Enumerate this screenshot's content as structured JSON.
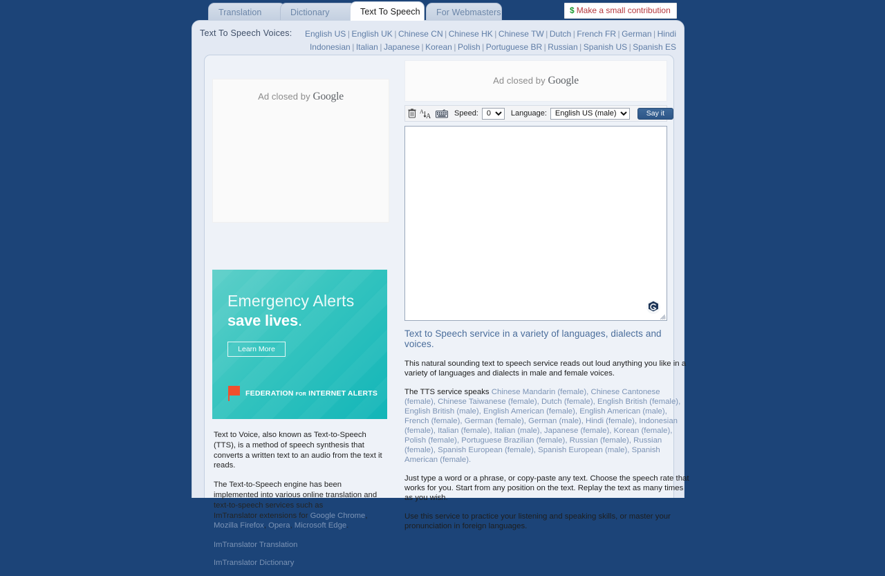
{
  "tabs": [
    {
      "label": "Translation",
      "active": false
    },
    {
      "label": "Dictionary",
      "active": false
    },
    {
      "label": "Text To Speech",
      "active": true
    },
    {
      "label": "For Webmasters",
      "active": false
    }
  ],
  "contribution": {
    "symbol": "$",
    "label": "Make a small contribution"
  },
  "voices": {
    "title": "Text To Speech Voices:",
    "row1": [
      "English US",
      "English UK",
      "Chinese CN",
      "Chinese HK",
      "Chinese TW",
      "Dutch",
      "French FR",
      "German",
      "Hindi"
    ],
    "row2": [
      "Indonesian",
      "Italian",
      "Japanese",
      "Korean",
      "Polish",
      "Portuguese BR",
      "Russian",
      "Spanish US",
      "Spanish ES"
    ],
    "separator": "|"
  },
  "ads": {
    "closed_text": "Ad closed by ",
    "google": "Google",
    "banner": {
      "line1": "Emergency Alerts",
      "line2": "save lives",
      "line2_dot": ".",
      "cta": "Learn More",
      "brand_1": "FEDERATION ",
      "brand_small": "FOR",
      "brand_2": " INTERNET ALERTS"
    }
  },
  "toolbar": {
    "icons": [
      "trash-icon",
      "font-size-icon",
      "keyboard-icon"
    ],
    "speed_label": "Speed:",
    "speed_value": "0",
    "speed_options": [
      "0"
    ],
    "language_label": "Language:",
    "language_value": "English US (male)",
    "language_options": [
      "English US (male)"
    ],
    "say_it_label": "Say it"
  },
  "textarea": {
    "value": "",
    "placeholder": ""
  },
  "left_column": {
    "para1": "Text to Voice, also known as Text-to-Speech (TTS), is a method of speech synthesis that converts a written text to an audio from the text it reads.",
    "para2_pre": "The Text-to-Speech engine has been implemented into various online translation and text-to-speech services such as",
    "para2_ext": "ImTranslator extensions for ",
    "links_inline": [
      "Google Chrome",
      "Mozilla Firefox",
      "Opera",
      "Microsoft Edge"
    ],
    "link1": "ImTranslator Translation",
    "link2": "ImTranslator Dictionary"
  },
  "description": {
    "heading": "Text to Speech service in a variety of languages, dialects and voices.",
    "para1": "This natural sounding text to speech service reads out loud anything you like in a variety of languages and dialects in male and female voices.",
    "para2_pre": "The TTS service speaks ",
    "voices_list": "Chinese Mandarin (female), Chinese Cantonese (female), Chinese Taiwanese (female), Dutch (female), English British (female), English British (male), English American (female), English American (male), French (female), German (female), German (male), Hindi (female), Indonesian (female), Italian (female), Italian (male), Japanese (female), Korean (female), Polish (female), Portuguese Brazilian (female), Russian (female), Russian (female), Spanish European (female), Spanish European (male), Spanish American (female).",
    "para3": "Just type a word or a phrase, or copy-paste any text. Choose the speech rate that works for you. Start from any position on the text. Replay the text as many times as you wish.",
    "para4": "Use this service to practice your listening and speaking skills, or master your pronunciation in foreign languages."
  },
  "colors": {
    "page_background": "#1c4478",
    "shell": "#e3e9f3",
    "content": "#eef2f8",
    "accent_link": "#5f7da6",
    "heading": "#4a6d9b",
    "button": "#2d5687",
    "banner_teal": "#12b5b8",
    "contribution_text": "#b4373c",
    "dollar_green": "#1f9b33"
  }
}
